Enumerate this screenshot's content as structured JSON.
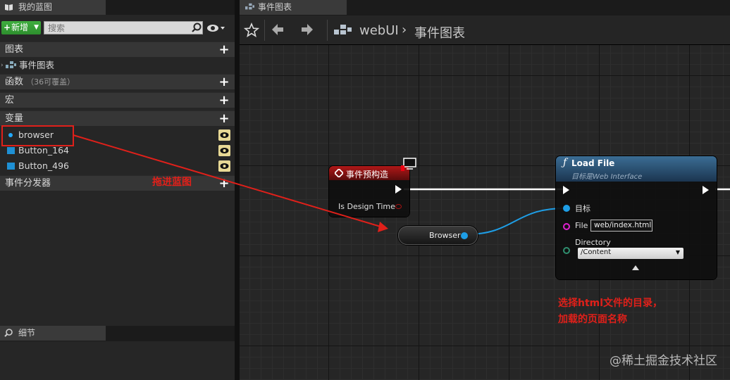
{
  "left_panel": {
    "tab_title": "我的蓝图",
    "new_button": "新增",
    "search_placeholder": "搜索",
    "categories": {
      "graphs": "图表",
      "graph_item": "事件图表",
      "functions": "函数",
      "functions_sub": "（36可覆盖）",
      "macros": "宏",
      "variables": "变量",
      "dispatchers": "事件分发器"
    },
    "variables": [
      {
        "name": "browser"
      },
      {
        "name": "Button_164"
      },
      {
        "name": "Button_496"
      }
    ],
    "details_tab": "细节"
  },
  "graph_panel": {
    "tab_title": "事件图表",
    "breadcrumb": {
      "blueprint": "webUI",
      "separator": "›",
      "graph": "事件图表"
    }
  },
  "nodes": {
    "construct": {
      "title": "事件预构造",
      "pin_label": "Is Design Time"
    },
    "browser": {
      "label": "Browser"
    },
    "load_file": {
      "title": "Load File",
      "subtitle": "目标是Web Interface",
      "target_label": "目标",
      "file_label": "File",
      "file_value": "web/index.html",
      "directory_label": "Directory",
      "directory_value": "/Content"
    }
  },
  "annotations": {
    "drag_hint": "拖进蓝图",
    "select_hint_line1": "选择html文件的目录，",
    "select_hint_line2": "加载的页面名称"
  },
  "watermark": "@稀土掘金技术社区",
  "colors": {
    "annotation_red": "#e0201a",
    "construct_header": "#8b1010",
    "load_file_header": "#2a5b84",
    "object_pin": "#1e9ee6",
    "string_pin": "#e020d0",
    "name_pin": "#2f8f6f",
    "new_button": "#3fae3f"
  }
}
